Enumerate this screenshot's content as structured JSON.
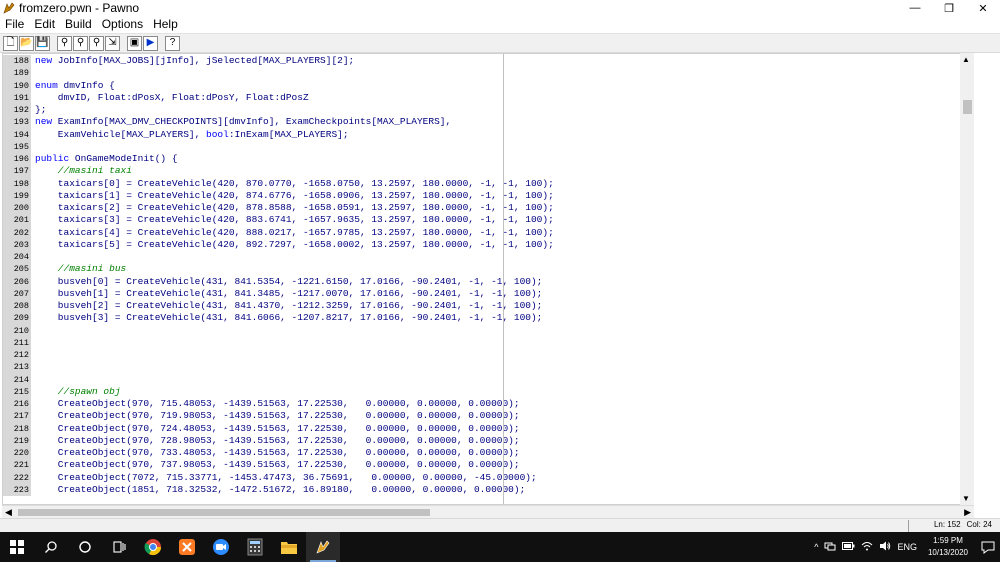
{
  "window": {
    "title": "fromzero.pwn - Pawno",
    "minimize_glyph": "—",
    "maximize_glyph": "❐",
    "close_glyph": "✕"
  },
  "menu": [
    "File",
    "Edit",
    "Build",
    "Options",
    "Help"
  ],
  "toolbar": [
    {
      "name": "new-file-button",
      "icon": "new-file-icon",
      "glyph": "🗋"
    },
    {
      "name": "open-file-button",
      "icon": "open-folder-icon",
      "glyph": "📂"
    },
    {
      "name": "save-file-button",
      "icon": "save-icon",
      "glyph": "💾"
    },
    {
      "name": "find-button",
      "icon": "binoculars-icon",
      "glyph": "⚲"
    },
    {
      "name": "find-next-button",
      "icon": "find-next-icon",
      "glyph": "⚲"
    },
    {
      "name": "replace-button",
      "icon": "replace-icon",
      "glyph": "⚲"
    },
    {
      "name": "goto-line-button",
      "icon": "goto-icon",
      "glyph": "⇲"
    },
    {
      "name": "compile-button",
      "icon": "compile-icon",
      "glyph": "▣"
    },
    {
      "name": "run-button",
      "icon": "play-icon",
      "glyph": "▶"
    },
    {
      "name": "help-button",
      "icon": "help-icon",
      "glyph": "?"
    }
  ],
  "editor": {
    "lines": [
      {
        "n": "188",
        "text": "new JobInfo[MAX_JOBS][jInfo], jSelected[MAX_PLAYERS][2];",
        "type": "code"
      },
      {
        "n": "189",
        "text": "",
        "type": "code"
      },
      {
        "n": "190",
        "text": "enum dmvInfo {",
        "type": "code"
      },
      {
        "n": "191",
        "text": "    dmvID, Float:dPosX, Float:dPosY, Float:dPosZ",
        "type": "code"
      },
      {
        "n": "192",
        "text": "};",
        "type": "code"
      },
      {
        "n": "193",
        "text": "new ExamInfo[MAX_DMV_CHECKPOINTS][dmvInfo], ExamCheckpoints[MAX_PLAYERS],",
        "type": "code"
      },
      {
        "n": "194",
        "text": "    ExamVehicle[MAX_PLAYERS], bool:InExam[MAX_PLAYERS];",
        "type": "code"
      },
      {
        "n": "195",
        "text": "",
        "type": "code"
      },
      {
        "n": "196",
        "text": "public OnGameModeInit() {",
        "type": "code"
      },
      {
        "n": "197",
        "text": "    //masini taxi",
        "type": "comment"
      },
      {
        "n": "198",
        "text": "    taxicars[0] = CreateVehicle(420, 870.0770, -1658.0750, 13.2597, 180.0000, -1, -1, 100);",
        "type": "code"
      },
      {
        "n": "199",
        "text": "    taxicars[1] = CreateVehicle(420, 874.6776, -1658.0906, 13.2597, 180.0000, -1, -1, 100);",
        "type": "code"
      },
      {
        "n": "200",
        "text": "    taxicars[2] = CreateVehicle(420, 878.8588, -1658.0591, 13.2597, 180.0000, -1, -1, 100);",
        "type": "code"
      },
      {
        "n": "201",
        "text": "    taxicars[3] = CreateVehicle(420, 883.6741, -1657.9635, 13.2597, 180.0000, -1, -1, 100);",
        "type": "code"
      },
      {
        "n": "202",
        "text": "    taxicars[4] = CreateVehicle(420, 888.0217, -1657.9785, 13.2597, 180.0000, -1, -1, 100);",
        "type": "code"
      },
      {
        "n": "203",
        "text": "    taxicars[5] = CreateVehicle(420, 892.7297, -1658.0002, 13.2597, 180.0000, -1, -1, 100);",
        "type": "code"
      },
      {
        "n": "204",
        "text": "",
        "type": "code"
      },
      {
        "n": "205",
        "text": "    //masini bus",
        "type": "comment"
      },
      {
        "n": "206",
        "text": "    busveh[0] = CreateVehicle(431, 841.5354, -1221.6150, 17.0166, -90.2401, -1, -1, 100);",
        "type": "code"
      },
      {
        "n": "207",
        "text": "    busveh[1] = CreateVehicle(431, 841.3485, -1217.0070, 17.0166, -90.2401, -1, -1, 100);",
        "type": "code"
      },
      {
        "n": "208",
        "text": "    busveh[2] = CreateVehicle(431, 841.4370, -1212.3259, 17.0166, -90.2401, -1, -1, 100);",
        "type": "code"
      },
      {
        "n": "209",
        "text": "    busveh[3] = CreateVehicle(431, 841.6066, -1207.8217, 17.0166, -90.2401, -1, -1, 100);",
        "type": "code"
      },
      {
        "n": "210",
        "text": "",
        "type": "code"
      },
      {
        "n": "211",
        "text": "",
        "type": "code"
      },
      {
        "n": "212",
        "text": "",
        "type": "code"
      },
      {
        "n": "213",
        "text": "",
        "type": "code"
      },
      {
        "n": "214",
        "text": "",
        "type": "code"
      },
      {
        "n": "215",
        "text": "    //spawn obj",
        "type": "comment"
      },
      {
        "n": "216",
        "text": "    CreateObject(970, 715.48053, -1439.51563, 17.22530,   0.00000, 0.00000, 0.00000);",
        "type": "code"
      },
      {
        "n": "217",
        "text": "    CreateObject(970, 719.98053, -1439.51563, 17.22530,   0.00000, 0.00000, 0.00000);",
        "type": "code"
      },
      {
        "n": "218",
        "text": "    CreateObject(970, 724.48053, -1439.51563, 17.22530,   0.00000, 0.00000, 0.00000);",
        "type": "code"
      },
      {
        "n": "219",
        "text": "    CreateObject(970, 728.98053, -1439.51563, 17.22530,   0.00000, 0.00000, 0.00000);",
        "type": "code"
      },
      {
        "n": "220",
        "text": "    CreateObject(970, 733.48053, -1439.51563, 17.22530,   0.00000, 0.00000, 0.00000);",
        "type": "code"
      },
      {
        "n": "221",
        "text": "    CreateObject(970, 737.98053, -1439.51563, 17.22530,   0.00000, 0.00000, 0.00000);",
        "type": "code"
      },
      {
        "n": "222",
        "text": "    CreateObject(7072, 715.33771, -1453.47473, 36.75691,   0.00000, 0.00000, -45.00000);",
        "type": "code"
      },
      {
        "n": "223",
        "text": "    CreateObject(1851, 718.32532, -1472.51672, 16.89180,   0.00000, 0.00000, 0.00000);",
        "type": "code"
      }
    ]
  },
  "scrollbars": {
    "up_glyph": "▲",
    "down_glyph": "▼",
    "left_glyph": "◀",
    "right_glyph": "▶"
  },
  "status": {
    "line": "Ln: 152",
    "col": "Col: 24"
  },
  "taskbar": {
    "apps": [
      {
        "name": "start-button",
        "icon": "windows-logo-icon",
        "glyph": "⊞",
        "active": false
      },
      {
        "name": "search-button",
        "icon": "search-icon",
        "glyph": "⚲",
        "active": false
      },
      {
        "name": "cortana-button",
        "icon": "circle-icon",
        "glyph": "○",
        "active": false
      },
      {
        "name": "task-view-button",
        "icon": "task-view-icon",
        "glyph": "⧉",
        "active": false
      },
      {
        "name": "chrome-app",
        "icon": "chrome-icon",
        "glyph": "●",
        "active": false
      },
      {
        "name": "xampp-app",
        "icon": "xampp-icon",
        "glyph": "⊠",
        "active": false
      },
      {
        "name": "zoom-app",
        "icon": "zoom-icon",
        "glyph": "▶",
        "active": false
      },
      {
        "name": "calculator-app",
        "icon": "calculator-icon",
        "glyph": "▦",
        "active": false
      },
      {
        "name": "file-explorer-app",
        "icon": "folder-icon",
        "glyph": "▬",
        "active": false
      },
      {
        "name": "pawno-app",
        "icon": "pawno-icon",
        "glyph": "✍",
        "active": true
      }
    ],
    "tray": {
      "chevron": "^",
      "network": "🖧",
      "battery": "▭",
      "volume": "🔊",
      "language": "ENG",
      "time": "1:59 PM",
      "date": "10/13/2020",
      "notification": "🗨"
    }
  },
  "colors": {
    "keyword": "#0000ff",
    "code": "#000080",
    "comment": "#008000",
    "gutter": "#d8d8d8",
    "taskbar": "#101010"
  }
}
